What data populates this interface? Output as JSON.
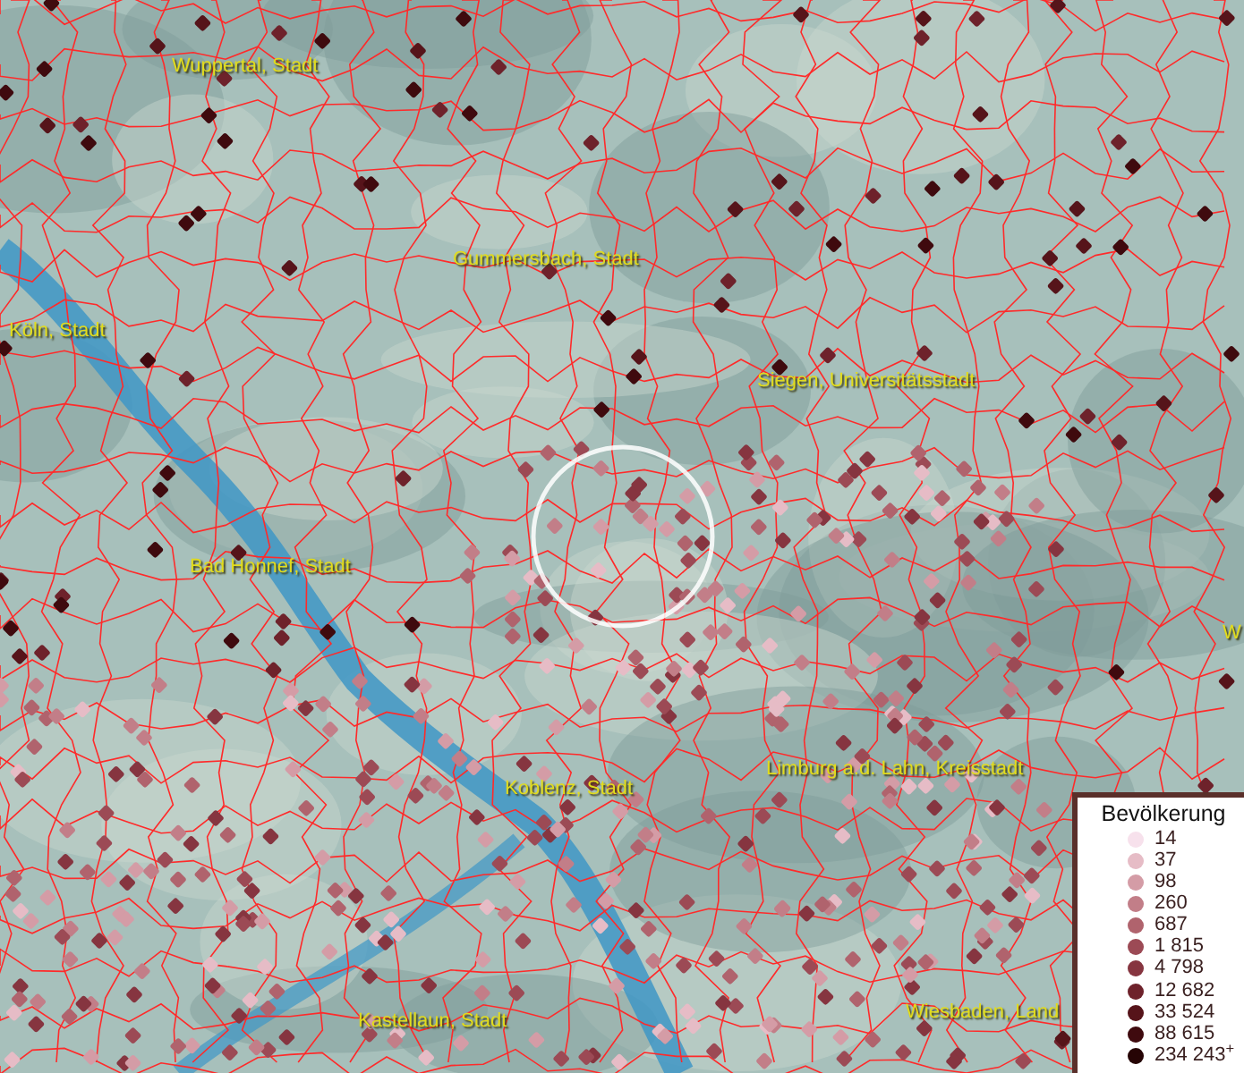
{
  "map": {
    "places": [
      {
        "name": "Wuppertal, Stadt"
      },
      {
        "name": "Gummersbach, Stadt"
      },
      {
        "name": "Köln, Stadt"
      },
      {
        "name": "Siegen, Universitätsstadt"
      },
      {
        "name": "Bad Honnef, Stadt"
      },
      {
        "name": "W"
      },
      {
        "name": "Koblenz, Stadt"
      },
      {
        "name": "Limburg a.d. Lahn, Kreisstadt"
      },
      {
        "name": "Kastellaun, Stadt"
      },
      {
        "name": "Wiesbaden, Land"
      }
    ]
  },
  "legend": {
    "title": "Bevölkerung",
    "classes": [
      {
        "label": "14",
        "color": "#f7e1ec"
      },
      {
        "label": "37",
        "color": "#e6bcc6"
      },
      {
        "label": "98",
        "color": "#d49ca6"
      },
      {
        "label": "260",
        "color": "#c27e88"
      },
      {
        "label": "687",
        "color": "#b0636d"
      },
      {
        "label": "1 815",
        "color": "#9c4a55"
      },
      {
        "label": "4 798",
        "color": "#863540"
      },
      {
        "label": "12 682",
        "color": "#6e222b"
      },
      {
        "label": "33 524",
        "color": "#56141a"
      },
      {
        "label": "88 615",
        "color": "#3f0a0e"
      },
      {
        "label": "234 243$^{+}$",
        "color": "#260405"
      }
    ]
  }
}
